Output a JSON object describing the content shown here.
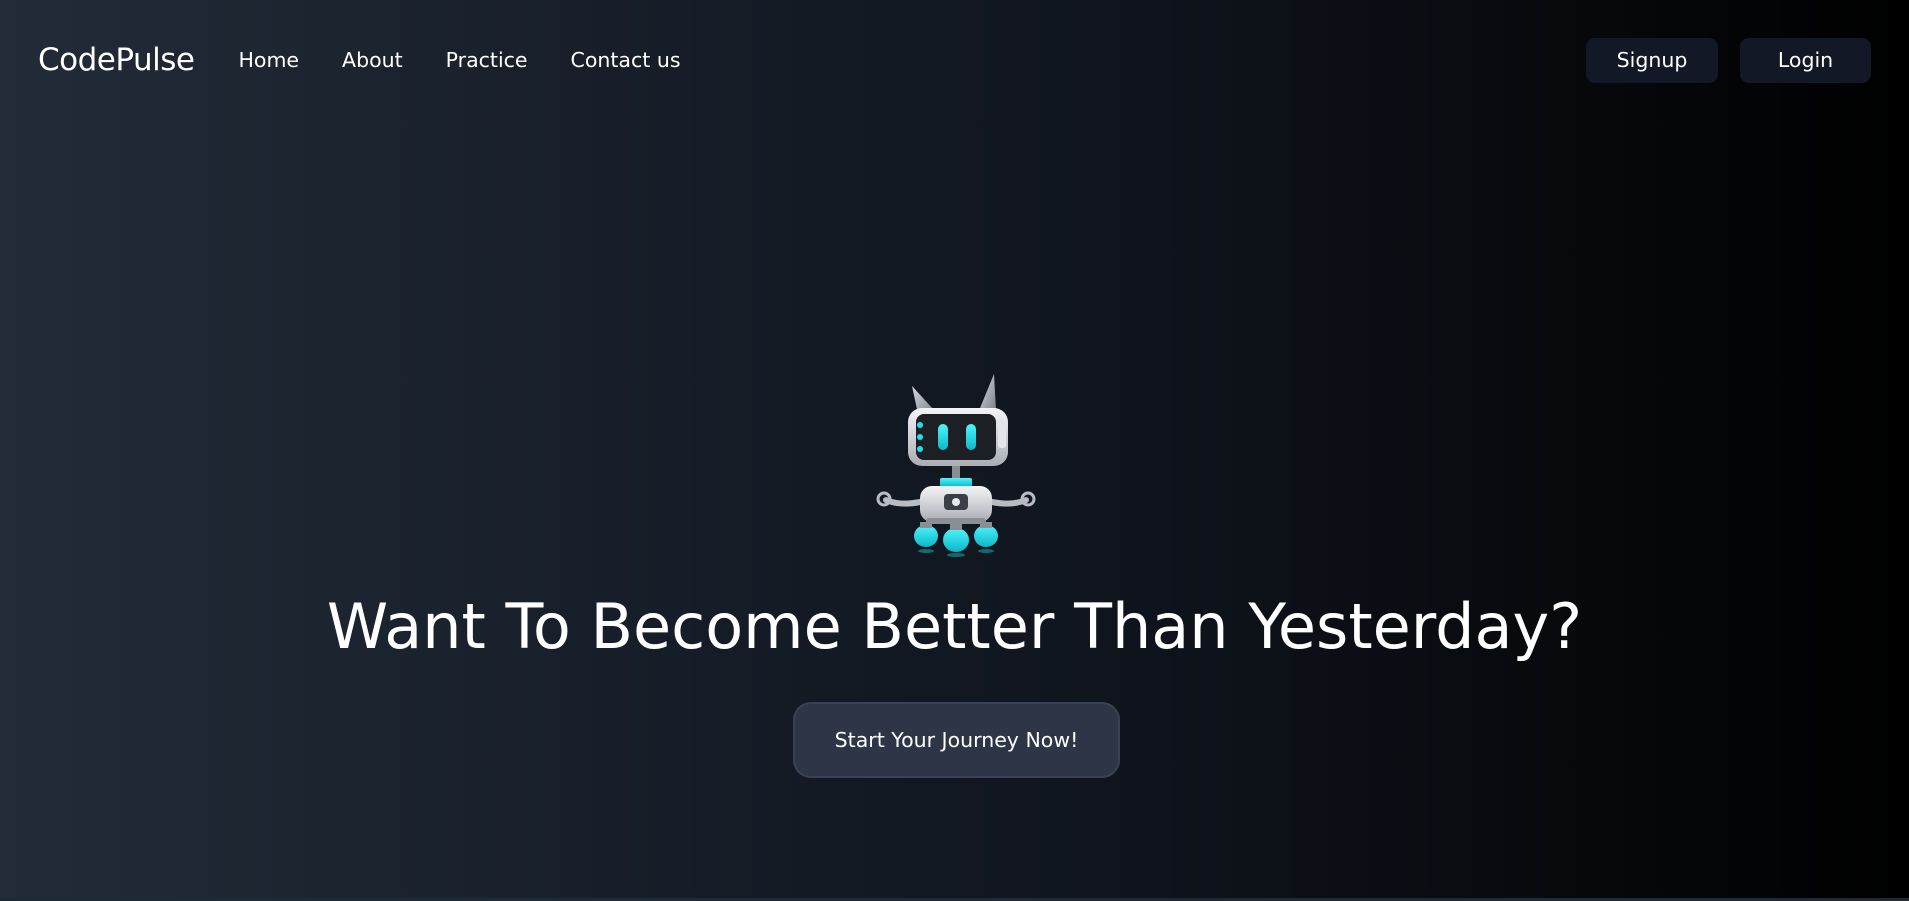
{
  "nav": {
    "brand": "CodePulse",
    "links": [
      {
        "label": "Home"
      },
      {
        "label": "About"
      },
      {
        "label": "Practice"
      },
      {
        "label": "Contact us"
      }
    ],
    "signup_label": "Signup",
    "login_label": "Login"
  },
  "hero": {
    "headline": "Want To Become Better Than Yesterday?",
    "cta_label": "Start Your Journey Now!",
    "mascot_icon": "robot-mascot-icon"
  },
  "colors": {
    "background_start": "#222b38",
    "background_end": "#000000",
    "button_bg": "#121826",
    "cta_bg": "#2d3546",
    "accent_cyan": "#19e3f0"
  }
}
